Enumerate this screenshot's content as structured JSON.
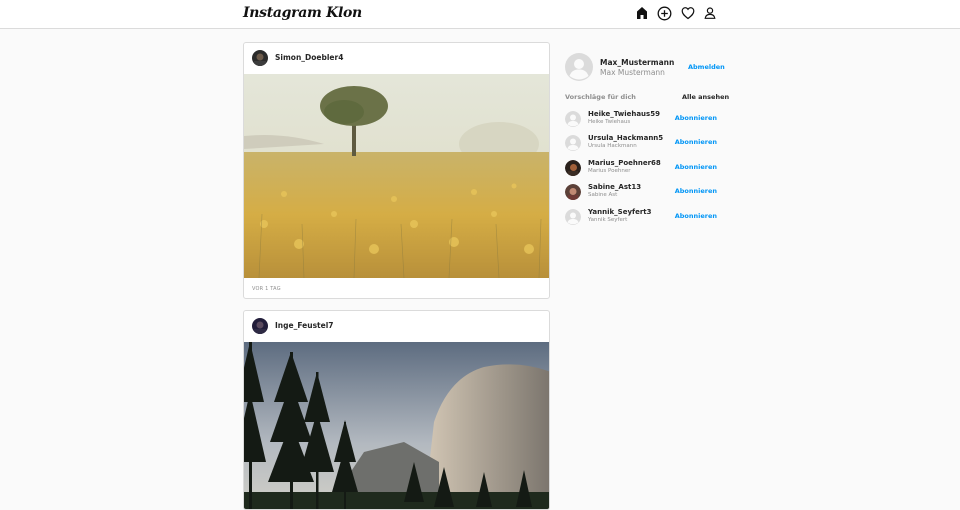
{
  "app": {
    "logo": "Instagram Klon"
  },
  "nav": {
    "icons": [
      "home-icon",
      "add-post-icon",
      "heart-icon",
      "profile-icon"
    ]
  },
  "posts": [
    {
      "username": "Simon_Doebler4",
      "time": "VOR 1 TAG",
      "image": "meadow-tree-photo"
    },
    {
      "username": "Inge_Feustel7",
      "time": "",
      "image": "mountain-forest-photo"
    }
  ],
  "sidebar": {
    "user": {
      "username": "Max_Mustermann",
      "name": "Max Mustermann",
      "logout_label": "Abmelden"
    },
    "suggestions_title": "Vorschläge für dich",
    "see_all_label": "Alle ansehen",
    "suggestions": [
      {
        "username": "Heike_Twiehaus59",
        "name": "Heike Twiehaus",
        "follow_label": "Abonnieren"
      },
      {
        "username": "Ursula_Hackmann5",
        "name": "Ursula Hackmann",
        "follow_label": "Abonnieren"
      },
      {
        "username": "Marius_Poehner68",
        "name": "Marius Poehner",
        "follow_label": "Abonnieren"
      },
      {
        "username": "Sabine_Ast13",
        "name": "Sabine Ast",
        "follow_label": "Abonnieren"
      },
      {
        "username": "Yannik_Seyfert3",
        "name": "Yannik Seyfert",
        "follow_label": "Abonnieren"
      }
    ]
  },
  "colors": {
    "accent": "#0095f6",
    "muted": "#8e8e8e",
    "border": "#dbdbdb",
    "background": "#fafafa"
  }
}
